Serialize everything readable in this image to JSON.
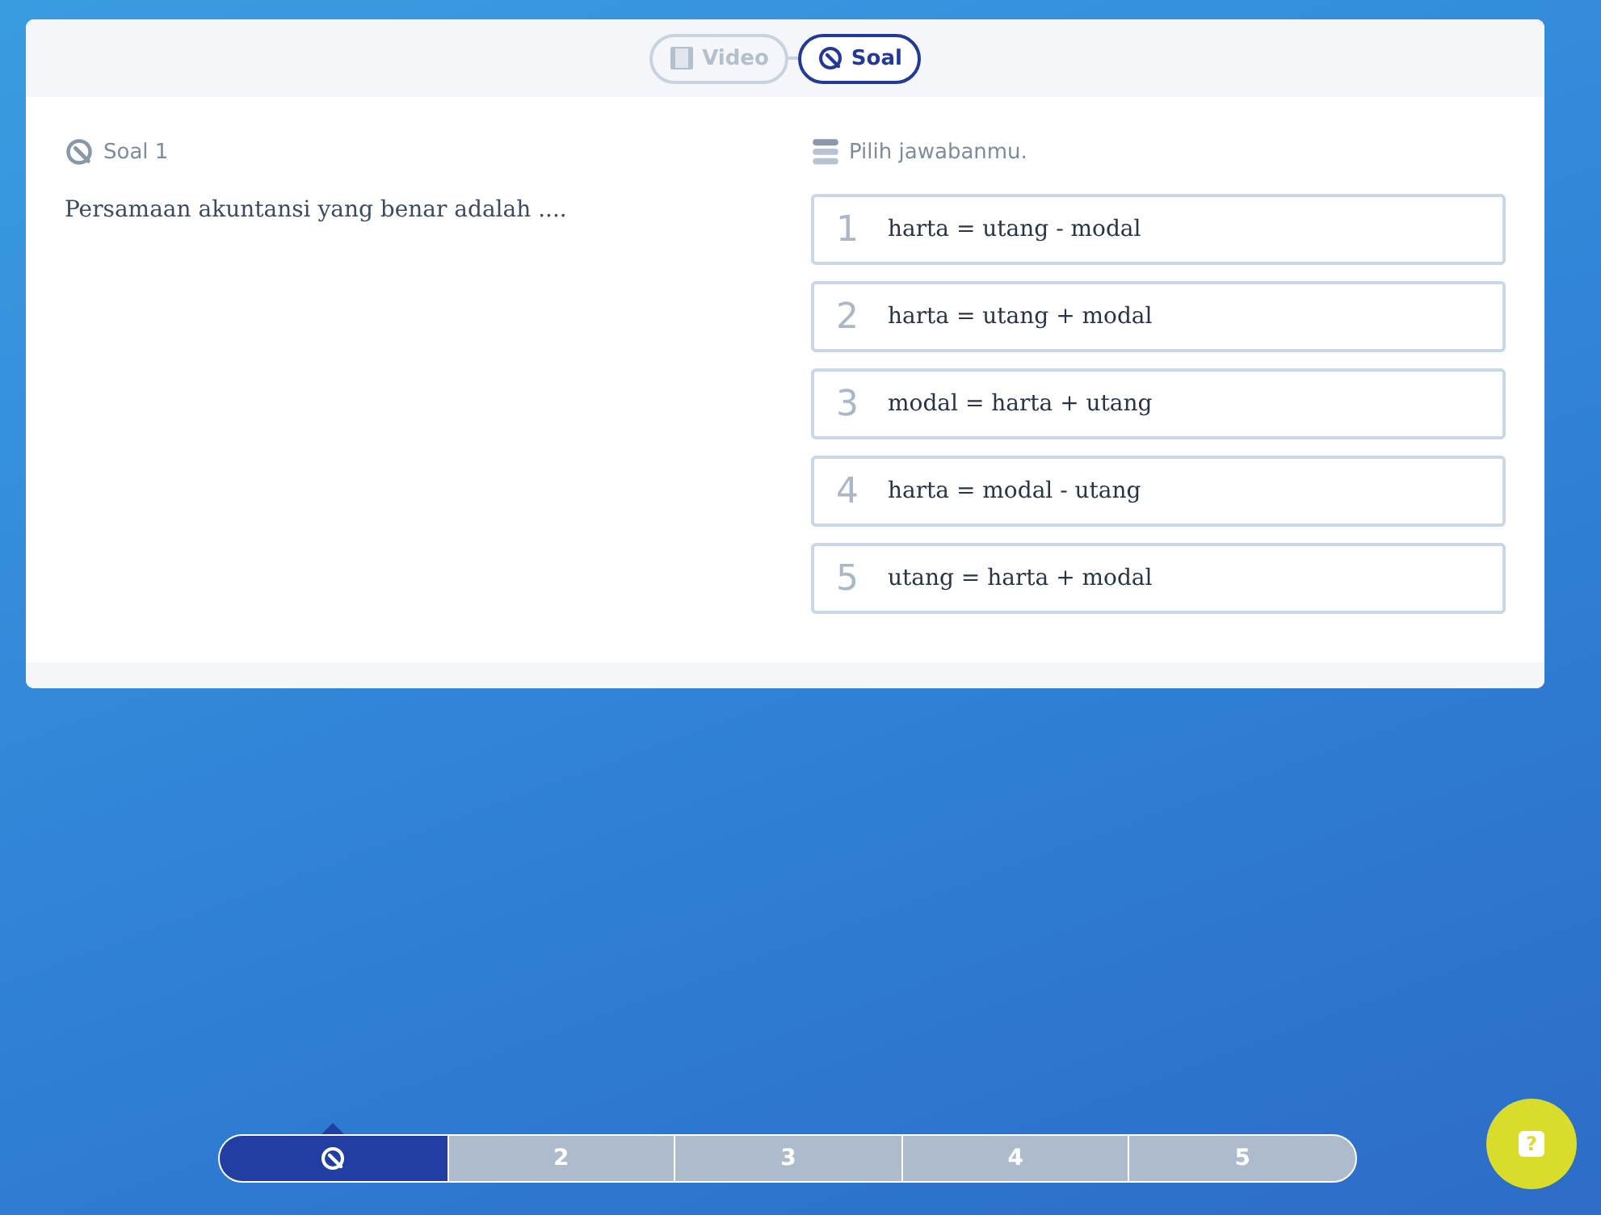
{
  "tabs": [
    {
      "label": "Video",
      "kind": "film",
      "selected": false
    },
    {
      "label": "Soal",
      "kind": "quiz",
      "selected": true
    }
  ],
  "question": {
    "label": "Soal 1",
    "text": "Persamaan akuntansi yang benar adalah ...."
  },
  "answers": {
    "heading": "Pilih jawabanmu.",
    "options": [
      {
        "number": "1",
        "text": "harta = utang - modal"
      },
      {
        "number": "2",
        "text": "harta = utang + modal"
      },
      {
        "number": "3",
        "text": "modal = harta + utang"
      },
      {
        "number": "4",
        "text": "harta = modal - utang"
      },
      {
        "number": "5",
        "text": "utang = harta + modal"
      }
    ]
  },
  "navigation": [
    {
      "kind": "icon",
      "selected": true
    },
    {
      "kind": "text",
      "label": "2",
      "selected": false
    },
    {
      "kind": "text",
      "label": "3",
      "selected": false
    },
    {
      "kind": "text",
      "label": "4",
      "selected": false
    },
    {
      "kind": "text",
      "label": "5",
      "selected": false
    }
  ],
  "help": {
    "label": "?"
  }
}
